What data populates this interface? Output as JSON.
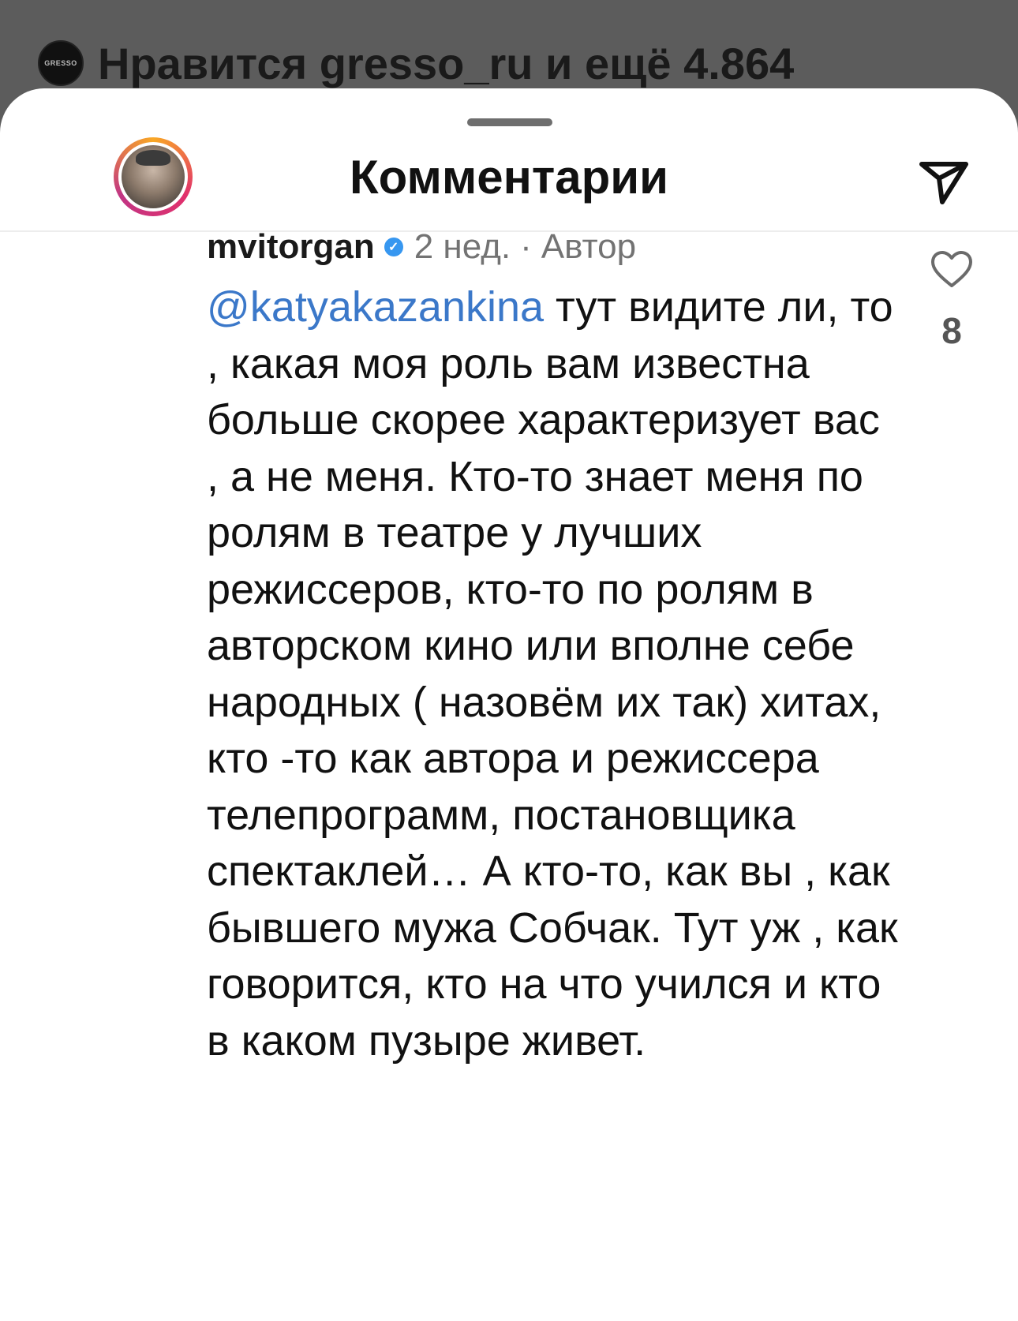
{
  "likes_banner": {
    "avatar_label": "GRESSO",
    "text": "Нравится gresso_ru и ещё 4.864"
  },
  "sheet": {
    "title": "Комментарии"
  },
  "comment": {
    "username": "mvitorgan",
    "time": "2 нед.",
    "separator": "·",
    "author_badge": "Автор",
    "mention": "@katyakazankina",
    "text": " тут видите ли, то , какая моя роль вам известна больше скорее характеризует вас , а не меня. Кто-то знает меня по ролям в театре у лучших режиссеров, кто-то по ролям в авторском кино или вполне себе народных ( назовём их так) хитах, кто -то как автора и режиссера телепрограмм, постановщика спектаклей… А кто-то, как вы , как бывшего мужа Собчак. Тут уж , как говорится, кто на что учился и кто  в каком пузыре живет.",
    "like_count": "8"
  },
  "icons": {
    "share": "paper-plane-icon",
    "like": "heart-icon",
    "verified": "verified-badge-icon"
  },
  "colors": {
    "mention": "#3b78c9",
    "verified": "#3797f0",
    "meta": "#737373"
  }
}
